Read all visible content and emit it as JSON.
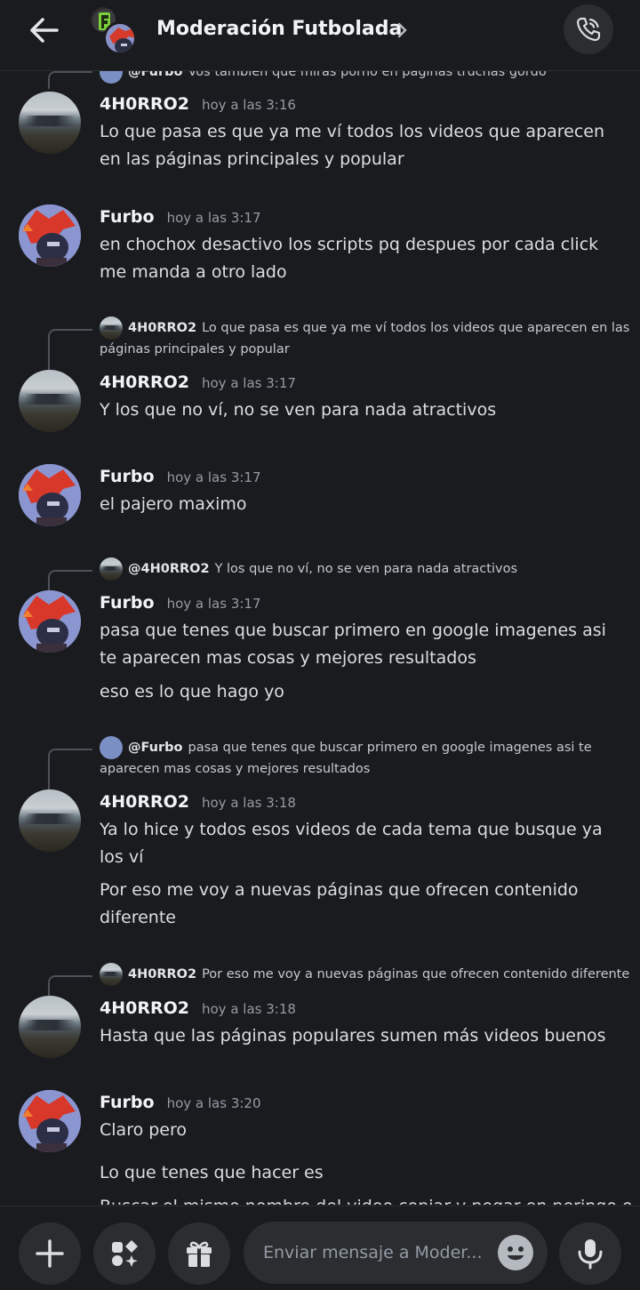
{
  "header": {
    "title": "Moderación Futbolada",
    "back_icon": "arrow-left-icon",
    "call_icon": "phone-call-icon"
  },
  "messages": [
    {
      "reply": {
        "name": "@Furbo",
        "text": "Vos también que miras porno en páginas truchas gordo"
      },
      "author": "4H0RRO2",
      "time": "hoy a las 3:16",
      "lines": [
        "Lo que pasa es que ya me ví todos los videos que aparecen en las páginas principales y popular"
      ]
    },
    {
      "author": "Furbo",
      "time": "hoy a las 3:17",
      "lines": [
        "en chochox desactivo los scripts pq despues por cada click me manda a otro lado"
      ]
    },
    {
      "reply": {
        "name": "4H0RRO2",
        "text": "Lo que pasa es que ya me ví todos los videos que aparecen en las páginas principales y popular"
      },
      "author": "4H0RRO2",
      "time": "hoy a las 3:17",
      "lines": [
        "Y los que no ví, no se ven para nada atractivos"
      ]
    },
    {
      "author": "Furbo",
      "time": "hoy a las 3:17",
      "lines": [
        "el pajero maximo"
      ]
    },
    {
      "reply": {
        "name": "@4H0RRO2",
        "text": "Y los que no ví, no se ven para nada atractivos"
      },
      "author": "Furbo",
      "time": "hoy a las 3:17",
      "lines": [
        "pasa que tenes que buscar primero en google imagenes asi te aparecen mas cosas y mejores resultados",
        "eso es lo que hago yo"
      ]
    },
    {
      "reply": {
        "name": "@Furbo",
        "text": "pasa que tenes que buscar primero en google imagenes asi te aparecen mas cosas y mejores resultados"
      },
      "author": "4H0RRO2",
      "time": "hoy a las 3:18",
      "lines": [
        "Ya lo hice y todos esos videos de cada tema que busque ya los ví",
        "Por eso me voy a nuevas páginas que ofrecen contenido diferente"
      ]
    },
    {
      "reply": {
        "name": "4H0RRO2",
        "text": "Por eso me voy a nuevas páginas que ofrecen contenido diferente"
      },
      "author": "4H0RRO2",
      "time": "hoy a las 3:18",
      "lines": [
        "Hasta que las páginas populares sumen más videos buenos"
      ]
    },
    {
      "author": "Furbo",
      "time": "hoy a las 3:20",
      "lines": [
        "Claro pero",
        "Lo que tenes que hacer es",
        "Buscar el mismo nombre del video copiar y pegar en peringo o"
      ]
    }
  ],
  "composer": {
    "placeholder": "Enviar mensaje a Moder...",
    "icons": [
      "plus-icon",
      "apps-icon",
      "gift-icon",
      "emoji-icon",
      "microphone-icon"
    ]
  }
}
